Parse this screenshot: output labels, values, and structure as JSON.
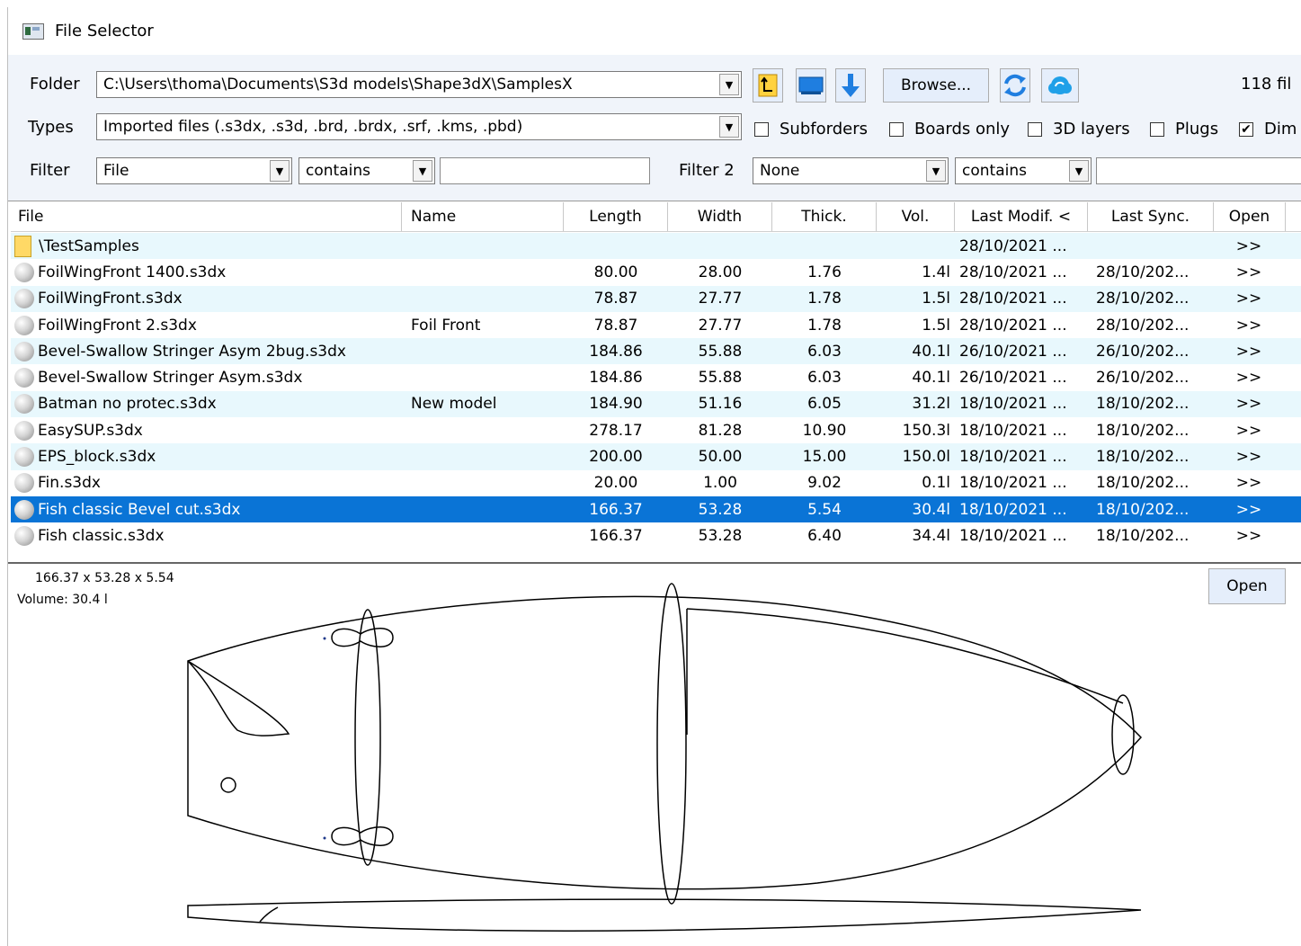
{
  "window": {
    "title": "File Selector"
  },
  "toolbar": {
    "folder_label": "Folder",
    "folder_value": "C:\\Users\\thoma\\Documents\\S3d models\\Shape3dX\\SamplesX",
    "types_label": "Types",
    "types_value": "Imported files (.s3dx, .s3d, .brd, .brdx, .srf, .kms, .pbd)",
    "filter_label": "Filter",
    "filter_field": "File",
    "filter_op": "contains",
    "filter_text": "",
    "filter2_label": "Filter 2",
    "filter2_field": "None",
    "filter2_op": "contains",
    "filter2_text": "",
    "browse_label": "Browse...",
    "file_count": "118 fil",
    "checkboxes": [
      {
        "label": "Subforders",
        "checked": false
      },
      {
        "label": "Boards only",
        "checked": false
      },
      {
        "label": "3D layers",
        "checked": false
      },
      {
        "label": "Plugs",
        "checked": false
      },
      {
        "label": "Dim",
        "checked": true
      }
    ],
    "check_mark": "✔",
    "icons": [
      "folder-up-icon",
      "monitor-icon",
      "download-arrow-icon",
      "refresh-icon",
      "cloud-icon"
    ]
  },
  "columns": [
    "File",
    "Name",
    "Length",
    "Width",
    "Thick.",
    "Vol.",
    "Last Modif. <",
    "Last Sync.",
    "Open"
  ],
  "rows": [
    {
      "file": "\\TestSamples",
      "name": "",
      "length": "",
      "width": "",
      "thick": "",
      "vol": "",
      "modif": "28/10/2021 ...",
      "sync": "",
      "open": ">>",
      "folder": true
    },
    {
      "file": "FoilWingFront 1400.s3dx",
      "name": "",
      "length": "80.00",
      "width": "28.00",
      "thick": "1.76",
      "vol": "1.4l",
      "modif": "28/10/2021 ...",
      "sync": "28/10/202...",
      "open": ">>"
    },
    {
      "file": "FoilWingFront.s3dx",
      "name": "",
      "length": "78.87",
      "width": "27.77",
      "thick": "1.78",
      "vol": "1.5l",
      "modif": "28/10/2021 ...",
      "sync": "28/10/202...",
      "open": ">>"
    },
    {
      "file": "FoilWingFront 2.s3dx",
      "name": "Foil Front",
      "length": "78.87",
      "width": "27.77",
      "thick": "1.78",
      "vol": "1.5l",
      "modif": "28/10/2021 ...",
      "sync": "28/10/202...",
      "open": ">>"
    },
    {
      "file": "Bevel-Swallow Stringer Asym 2bug.s3dx",
      "name": "",
      "length": "184.86",
      "width": "55.88",
      "thick": "6.03",
      "vol": "40.1l",
      "modif": "26/10/2021 ...",
      "sync": "26/10/202...",
      "open": ">>"
    },
    {
      "file": "Bevel-Swallow Stringer Asym.s3dx",
      "name": "",
      "length": "184.86",
      "width": "55.88",
      "thick": "6.03",
      "vol": "40.1l",
      "modif": "26/10/2021 ...",
      "sync": "26/10/202...",
      "open": ">>"
    },
    {
      "file": "Batman no protec.s3dx",
      "name": "New model",
      "length": "184.90",
      "width": "51.16",
      "thick": "6.05",
      "vol": "31.2l",
      "modif": "18/10/2021 ...",
      "sync": "18/10/202...",
      "open": ">>"
    },
    {
      "file": "EasySUP.s3dx",
      "name": "",
      "length": "278.17",
      "width": "81.28",
      "thick": "10.90",
      "vol": "150.3l",
      "modif": "18/10/2021 ...",
      "sync": "18/10/202...",
      "open": ">>"
    },
    {
      "file": "EPS_block.s3dx",
      "name": "",
      "length": "200.00",
      "width": "50.00",
      "thick": "15.00",
      "vol": "150.0l",
      "modif": "18/10/2021 ...",
      "sync": "18/10/202...",
      "open": ">>"
    },
    {
      "file": "Fin.s3dx",
      "name": "",
      "length": "20.00",
      "width": "1.00",
      "thick": "9.02",
      "vol": "0.1l",
      "modif": "18/10/2021 ...",
      "sync": "18/10/202...",
      "open": ">>"
    },
    {
      "file": "Fish classic Bevel cut.s3dx",
      "name": "",
      "length": "166.37",
      "width": "53.28",
      "thick": "5.54",
      "vol": "30.4l",
      "modif": "18/10/2021 ...",
      "sync": "18/10/202...",
      "open": ">>",
      "selected": true
    },
    {
      "file": "Fish classic.s3dx",
      "name": "",
      "length": "166.37",
      "width": "53.28",
      "thick": "6.40",
      "vol": "34.4l",
      "modif": "18/10/2021 ...",
      "sync": "18/10/202...",
      "open": ">>"
    }
  ],
  "preview": {
    "dimensions": "166.37 x 53.28 x 5.54",
    "volume": "Volume:  30.4 l",
    "open_label": "Open"
  },
  "colors": {
    "selected_row": "#0a74d6",
    "alt_row": "#e8f8fd",
    "toolbar_bg": "#f0f4fa",
    "accent": "#1f7ee0"
  }
}
